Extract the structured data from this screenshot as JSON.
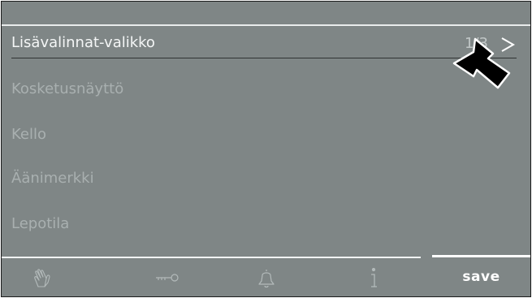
{
  "menu": {
    "active_item": "Lisävalinnat-valikko",
    "items": [
      "Kosketusnäyttö",
      "Kello",
      "Äänimerkki",
      "Lepotila"
    ]
  },
  "pagination": {
    "indicator": "1/3"
  },
  "bottom_bar": {
    "tabs": [
      {
        "icon": "hand-touch-icon"
      },
      {
        "icon": "key-icon"
      },
      {
        "icon": "bell-icon"
      },
      {
        "icon": "info-icon"
      }
    ],
    "save_label": "save"
  },
  "colors": {
    "background": "#7f8686",
    "active_text": "#f4f6f6",
    "inactive_text": "#a9b0b0",
    "accent": "#ffffff"
  }
}
